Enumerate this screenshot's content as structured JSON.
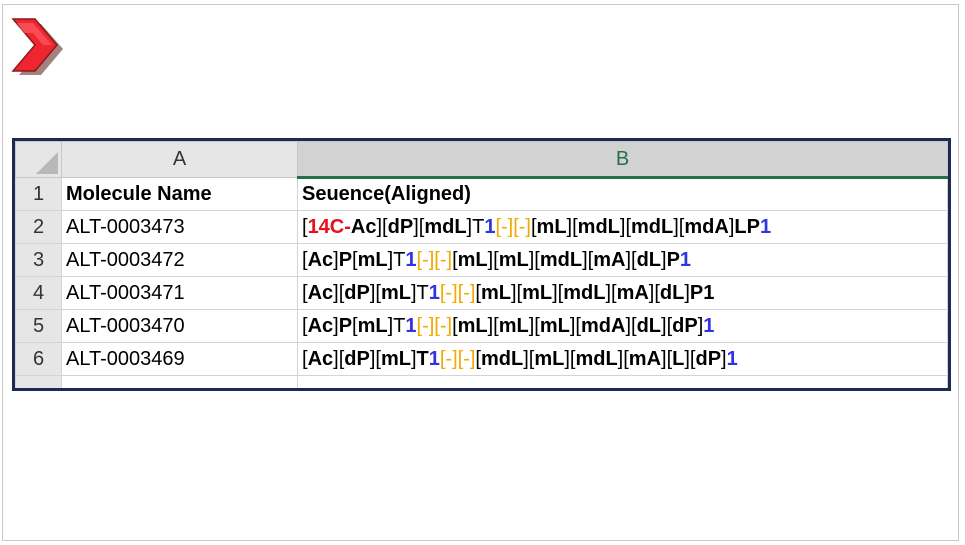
{
  "columns": {
    "a": "A",
    "b": "B"
  },
  "rows": [
    {
      "num": "1",
      "a": "Molecule Name",
      "bHeader": "Seuence(Aligned)"
    },
    {
      "num": "2",
      "a": "ALT-0003473",
      "seq": [
        {
          "t": "[",
          "s": ""
        },
        {
          "t": "14C-",
          "s": "red"
        },
        {
          "t": "Ac",
          "s": "bold"
        },
        {
          "t": "][",
          "s": ""
        },
        {
          "t": "dP",
          "s": "bold"
        },
        {
          "t": "][",
          "s": ""
        },
        {
          "t": "mdL",
          "s": "bold"
        },
        {
          "t": "]T",
          "s": ""
        },
        {
          "t": "1",
          "s": "blue"
        },
        {
          "t": "[-][-]",
          "s": "orange"
        },
        {
          "t": "[",
          "s": ""
        },
        {
          "t": "mL",
          "s": "bold"
        },
        {
          "t": "][",
          "s": ""
        },
        {
          "t": "mdL",
          "s": "bold"
        },
        {
          "t": "][",
          "s": ""
        },
        {
          "t": "mdL",
          "s": "bold"
        },
        {
          "t": "][",
          "s": ""
        },
        {
          "t": "mdA",
          "s": "bold"
        },
        {
          "t": "]",
          "s": ""
        },
        {
          "t": "LP",
          "s": "bold"
        },
        {
          "t": "1",
          "s": "blue"
        }
      ]
    },
    {
      "num": "3",
      "a": "ALT-0003472",
      "seq": [
        {
          "t": "[",
          "s": ""
        },
        {
          "t": "Ac",
          "s": "bold"
        },
        {
          "t": "]",
          "s": ""
        },
        {
          "t": "P",
          "s": "bold"
        },
        {
          "t": "[",
          "s": ""
        },
        {
          "t": "mL",
          "s": "bold"
        },
        {
          "t": "]T",
          "s": ""
        },
        {
          "t": "1",
          "s": "blue"
        },
        {
          "t": "[-][-]",
          "s": "orange"
        },
        {
          "t": "[",
          "s": ""
        },
        {
          "t": "mL",
          "s": "bold"
        },
        {
          "t": "][",
          "s": ""
        },
        {
          "t": "mL",
          "s": "bold"
        },
        {
          "t": "][",
          "s": ""
        },
        {
          "t": "mdL",
          "s": "bold"
        },
        {
          "t": "][",
          "s": ""
        },
        {
          "t": "mA",
          "s": "bold"
        },
        {
          "t": "][",
          "s": ""
        },
        {
          "t": "dL",
          "s": "bold"
        },
        {
          "t": "]",
          "s": ""
        },
        {
          "t": "P",
          "s": "bold"
        },
        {
          "t": "1",
          "s": "blue"
        }
      ]
    },
    {
      "num": "4",
      "a": "ALT-0003471",
      "seq": [
        {
          "t": "[",
          "s": ""
        },
        {
          "t": "Ac",
          "s": "bold"
        },
        {
          "t": "][",
          "s": ""
        },
        {
          "t": "dP",
          "s": "bold"
        },
        {
          "t": "][",
          "s": ""
        },
        {
          "t": "mL",
          "s": "bold"
        },
        {
          "t": "]T",
          "s": ""
        },
        {
          "t": "1",
          "s": "blue"
        },
        {
          "t": "[-][-]",
          "s": "orange"
        },
        {
          "t": "[",
          "s": ""
        },
        {
          "t": "mL",
          "s": "bold"
        },
        {
          "t": "][",
          "s": ""
        },
        {
          "t": "mL",
          "s": "bold"
        },
        {
          "t": "][",
          "s": ""
        },
        {
          "t": "mdL",
          "s": "bold"
        },
        {
          "t": "][",
          "s": ""
        },
        {
          "t": "mA",
          "s": "bold"
        },
        {
          "t": "][",
          "s": ""
        },
        {
          "t": "dL",
          "s": "bold"
        },
        {
          "t": "]",
          "s": ""
        },
        {
          "t": "P1",
          "s": "bold"
        }
      ]
    },
    {
      "num": "5",
      "a": "ALT-0003470",
      "seq": [
        {
          "t": "[",
          "s": ""
        },
        {
          "t": "Ac",
          "s": "bold"
        },
        {
          "t": "]",
          "s": ""
        },
        {
          "t": "P",
          "s": "bold"
        },
        {
          "t": "[",
          "s": ""
        },
        {
          "t": "mL",
          "s": "bold"
        },
        {
          "t": "]T",
          "s": ""
        },
        {
          "t": "1",
          "s": "blue"
        },
        {
          "t": "[-][-]",
          "s": "orange"
        },
        {
          "t": "[",
          "s": ""
        },
        {
          "t": "mL",
          "s": "bold"
        },
        {
          "t": "][",
          "s": ""
        },
        {
          "t": "mL",
          "s": "bold"
        },
        {
          "t": "][",
          "s": ""
        },
        {
          "t": "mL",
          "s": "bold"
        },
        {
          "t": "][",
          "s": ""
        },
        {
          "t": "mdA",
          "s": "bold"
        },
        {
          "t": "][",
          "s": ""
        },
        {
          "t": "dL",
          "s": "bold"
        },
        {
          "t": "][",
          "s": ""
        },
        {
          "t": "dP",
          "s": "bold"
        },
        {
          "t": "]",
          "s": ""
        },
        {
          "t": "1",
          "s": "blue"
        }
      ]
    },
    {
      "num": "6",
      "a": "ALT-0003469",
      "seq": [
        {
          "t": "[",
          "s": ""
        },
        {
          "t": "Ac",
          "s": "bold"
        },
        {
          "t": "][",
          "s": ""
        },
        {
          "t": "dP",
          "s": "bold"
        },
        {
          "t": "][",
          "s": ""
        },
        {
          "t": "mL",
          "s": "bold"
        },
        {
          "t": "]",
          "s": ""
        },
        {
          "t": "T",
          "s": "bold"
        },
        {
          "t": "1",
          "s": "blue"
        },
        {
          "t": "[-][-]",
          "s": "orange"
        },
        {
          "t": "[",
          "s": ""
        },
        {
          "t": "mdL",
          "s": "bold"
        },
        {
          "t": "][",
          "s": ""
        },
        {
          "t": "mL",
          "s": "bold"
        },
        {
          "t": "][",
          "s": ""
        },
        {
          "t": "mdL",
          "s": "bold"
        },
        {
          "t": "][",
          "s": ""
        },
        {
          "t": "mA",
          "s": "bold"
        },
        {
          "t": "][",
          "s": ""
        },
        {
          "t": "L",
          "s": "bold"
        },
        {
          "t": "][",
          "s": ""
        },
        {
          "t": "dP",
          "s": "bold"
        },
        {
          "t": "]",
          "s": ""
        },
        {
          "t": "1",
          "s": "blue"
        }
      ]
    }
  ],
  "colors": {
    "frame": "#1f2a54",
    "modRed": "#e8101a",
    "linkerBlue": "#2f35e4",
    "gapOrange": "#f2a900",
    "excelGreen": "#217346"
  }
}
